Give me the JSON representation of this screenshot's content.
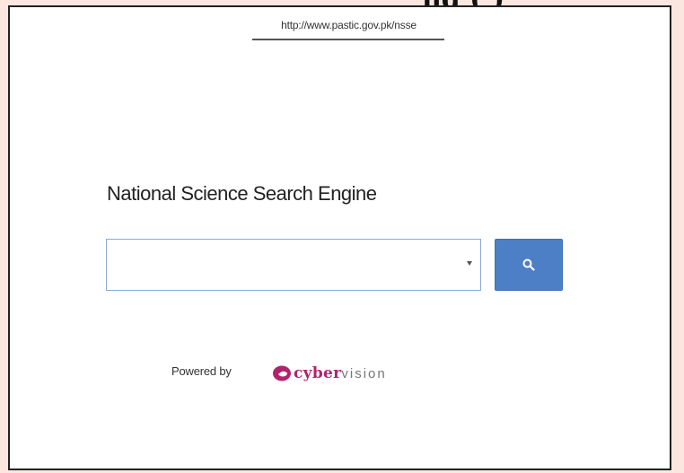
{
  "header_fragment": "ng   (        )",
  "url": "http://www.pastic.gov.pk/nsse",
  "title": "National Science Search Engine",
  "search": {
    "value": "",
    "placeholder": ""
  },
  "search_button_icon": "search-icon",
  "powered_by": "Powered by",
  "logo": {
    "part1": "cyber",
    "part2": "vision",
    "brand_color": "#b0246d"
  },
  "colors": {
    "button": "#4d7fc7",
    "input_border": "#8aa9d6",
    "background": "#fbe7df"
  }
}
